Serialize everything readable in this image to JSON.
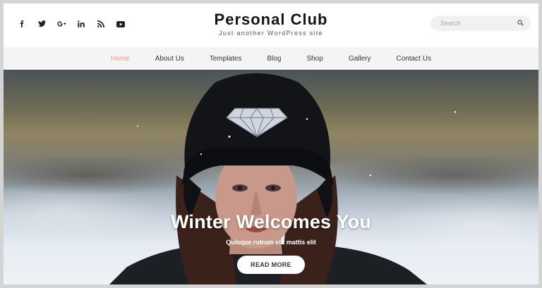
{
  "site": {
    "title": "Personal Club",
    "tagline": "Just another WordPress site"
  },
  "social": [
    {
      "icon": "facebook-icon"
    },
    {
      "icon": "twitter-icon"
    },
    {
      "icon": "google-plus-icon"
    },
    {
      "icon": "linkedin-icon"
    },
    {
      "icon": "rss-icon"
    },
    {
      "icon": "youtube-icon"
    }
  ],
  "search": {
    "placeholder": "Search",
    "icon": "search-icon"
  },
  "nav": {
    "items": [
      {
        "label": "Home",
        "active": true
      },
      {
        "label": "About Us"
      },
      {
        "label": "Templates"
      },
      {
        "label": "Blog"
      },
      {
        "label": "Shop"
      },
      {
        "label": "Gallery"
      },
      {
        "label": "Contact Us"
      }
    ],
    "active_color": "#f29a70"
  },
  "hero": {
    "title": "Winter Welcomes You",
    "subtitle": "Quisque rutrum elit mattis elit",
    "button_label": "READ MORE"
  }
}
